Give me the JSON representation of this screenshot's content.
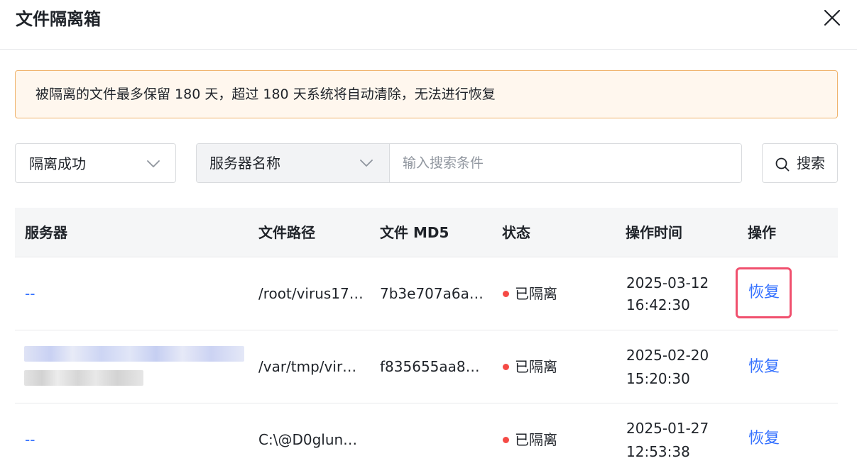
{
  "dialog": {
    "title": "文件隔离箱",
    "close_icon": "close-icon"
  },
  "notice": {
    "text": "被隔离的文件最多保留 180 天，超过 180 天系统将自动清除，无法进行恢复",
    "border_color": "#f0b46e",
    "background": "#fff7ee"
  },
  "filters": {
    "status_select": {
      "value": "隔离成功"
    },
    "field_select": {
      "value": "服务器名称"
    },
    "search": {
      "placeholder": "输入搜索条件",
      "value": ""
    },
    "search_button": {
      "label": "搜索",
      "icon": "search-icon"
    }
  },
  "table": {
    "columns": [
      "服务器",
      "文件路径",
      "文件 MD5",
      "状态",
      "操作时间",
      "操作"
    ],
    "rows": [
      {
        "server": "--",
        "server_blurred": false,
        "path": "/root/virus17…",
        "md5": "7b3e707a6a…",
        "status": "已隔离",
        "time_date": "2025-03-12",
        "time_clock": "16:42:30",
        "action": "恢复",
        "action_highlighted": true
      },
      {
        "server": "",
        "server_blurred": true,
        "path": "/var/tmp/viru…",
        "md5": "f835655aa8…",
        "status": "已隔离",
        "time_date": "2025-02-20",
        "time_clock": "15:20:30",
        "action": "恢复",
        "action_highlighted": false
      },
      {
        "server": "--",
        "server_blurred": false,
        "path": "C:\\@D0glun…",
        "md5": "",
        "status": "已隔离",
        "time_date": "2025-01-27",
        "time_clock": "12:53:38",
        "action": "恢复",
        "action_highlighted": false
      }
    ]
  },
  "colors": {
    "link": "#3370ff",
    "status_dot": "#f54a45",
    "highlight": "#f0506e",
    "header_bg": "#f5f6f7"
  }
}
